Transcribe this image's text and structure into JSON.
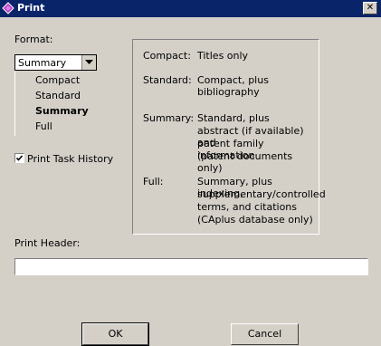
{
  "window": {
    "title": "Print",
    "close_glyph": "✕"
  },
  "format": {
    "label": "Format:",
    "selected": "Summary",
    "options": [
      "Compact",
      "Standard",
      "Summary",
      "Full"
    ]
  },
  "print_task_history": {
    "label": "Print Task History",
    "checked": true
  },
  "descriptions": [
    {
      "term": "Compact:",
      "lines": [
        "Titles only"
      ]
    },
    {
      "term": "Standard:",
      "lines": [
        "Compact, plus",
        "bibliography"
      ]
    },
    {
      "term": "Summary:",
      "lines": [
        "Standard, plus",
        "abstract (if available) and",
        "patent family information",
        "(patent documents only)"
      ]
    },
    {
      "term": "Full:",
      "lines": [
        "Summary, plus indexing,",
        "supplementary/controlled",
        "terms, and citations",
        "(CAplus database only)"
      ]
    }
  ],
  "print_header": {
    "label": "Print Header:",
    "value": ""
  },
  "buttons": {
    "ok": "OK",
    "cancel": "Cancel"
  },
  "colors": {
    "title_bar": "#0a246a",
    "dialog_bg": "#d4d0c8"
  }
}
